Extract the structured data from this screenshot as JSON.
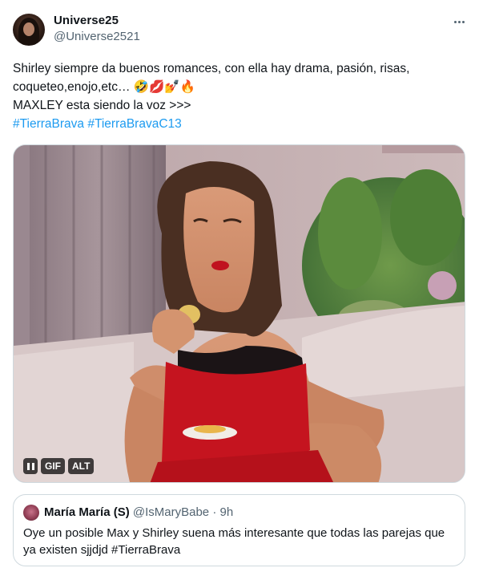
{
  "author": {
    "display_name": "Universe25",
    "handle": "@Universe2521"
  },
  "more_icon": "more-horizontal-icon",
  "tweet": {
    "line1": "Shirley siempre da buenos romances, con ella hay drama, pasión, risas,",
    "line2": "coqueteo,enojo,etc… 🤣💋💅🔥",
    "line3": "MAXLEY esta siendo la voz >>>",
    "hashtag1": "#TierraBrava",
    "hashtag2": "#TierraBravaC13"
  },
  "media": {
    "type": "gif",
    "pause_icon": "pause-icon",
    "gif_label": "GIF",
    "alt_label": "ALT"
  },
  "quoted_tweet": {
    "display_name": "María María (S)",
    "handle": "@IsMaryBabe",
    "separator": "·",
    "time": "9h",
    "text": "Oye un posible Max y Shirley suena más interesante que todas las parejas que ya existen sjjdjd #TierraBrava"
  },
  "colors": {
    "link": "#1d9bf0",
    "secondary_text": "#536471",
    "primary_text": "#0f1419",
    "border": "#cfd9de",
    "dress": "#c5141f"
  }
}
